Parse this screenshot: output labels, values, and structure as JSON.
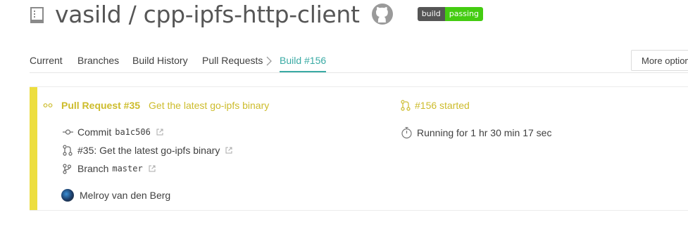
{
  "header": {
    "repo_title": "vasild / cpp-ipfs-http-client",
    "badge": {
      "label": "build",
      "status": "passing"
    },
    "icons": {
      "repo": "repo-icon",
      "github": "github-icon"
    }
  },
  "tabs": {
    "items": [
      "Current",
      "Branches",
      "Build History",
      "Pull Requests",
      "Build #156"
    ],
    "more_label": "More options"
  },
  "build": {
    "status_color": "#edde3f",
    "pr_label": "Pull Request #35",
    "pr_title": "Get the latest go-ipfs binary",
    "commit_label": "Commit",
    "commit_hash": "ba1c506",
    "pr_ref": "#35: Get the latest go-ipfs binary",
    "branch_label": "Branch",
    "branch_name": "master",
    "author": "Melroy van den Berg",
    "build_status": "#156 started",
    "duration": "Running for 1 hr 30 min 17 sec"
  }
}
